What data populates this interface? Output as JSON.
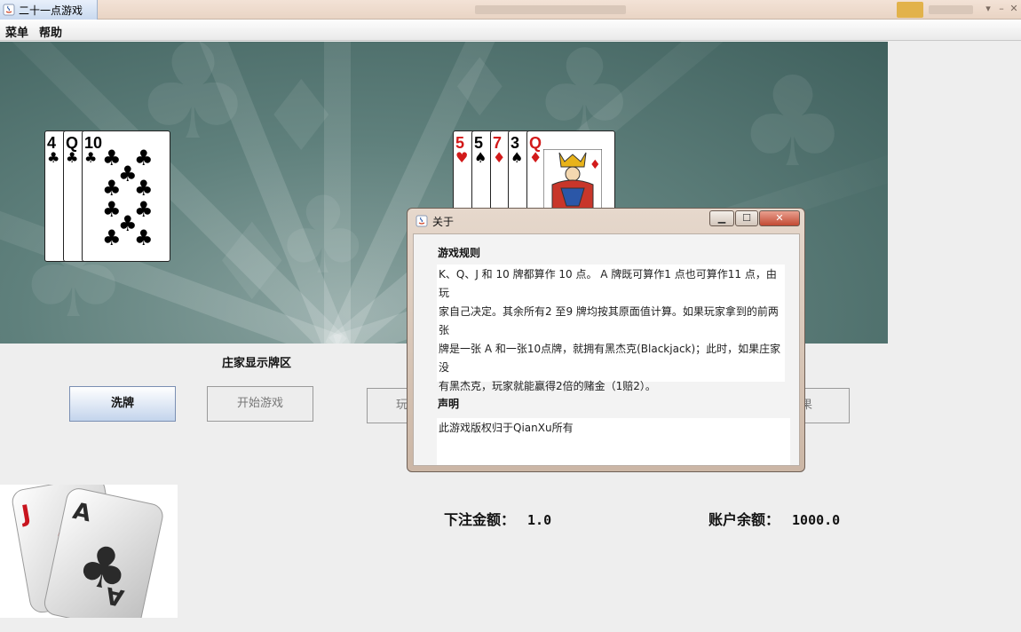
{
  "window": {
    "title": "二十一点游戏"
  },
  "menu": {
    "items": [
      "菜单",
      "帮助"
    ]
  },
  "dealer_hand": [
    {
      "rank": "4",
      "suit": "♣",
      "color": "black"
    },
    {
      "rank": "Q",
      "suit": "♣",
      "color": "black"
    },
    {
      "rank": "10",
      "suit": "♣",
      "color": "black"
    }
  ],
  "player_hand": [
    {
      "rank": "5",
      "suit": "♥",
      "color": "red"
    },
    {
      "rank": "5",
      "suit": "♠",
      "color": "black"
    },
    {
      "rank": "7",
      "suit": "♦",
      "color": "red"
    },
    {
      "rank": "3",
      "suit": "♠",
      "color": "black"
    },
    {
      "rank": "Q",
      "suit": "♦",
      "color": "red"
    }
  ],
  "labels": {
    "dealer_area": "庄家显示牌区"
  },
  "buttons": {
    "shuffle": "洗牌",
    "start": "开始游戏",
    "play_partial": "玩",
    "result_partial": "果"
  },
  "money": {
    "bet_label": "下注金额：",
    "bet_value": "1.0",
    "balance_label": "账户余额：",
    "balance_value": "1000.0"
  },
  "logo": {
    "card1_rank": "J",
    "card2_rank": "A"
  },
  "dialog": {
    "title": "关于",
    "rules_heading": "游戏规则",
    "rules_lines": [
      "K、Q、J 和 10 牌都算作 10 点。 A 牌既可算作1 点也可算作11 点，由玩",
      "家自己决定。其余所有2 至9 牌均按其原面值计算。如果玩家拿到的前两张",
      "牌是一张 A 和一张10点牌，就拥有黑杰克(Blackjack)；此时，如果庄家没",
      "有黑杰克，玩家就能赢得2倍的赌金（1赔2）。"
    ],
    "notice_heading": "声明",
    "notice_text": "此游戏版权归于QianXu所有"
  },
  "colors": {
    "table_green": "#5f807c",
    "button_blue": "#c3d4ec"
  }
}
